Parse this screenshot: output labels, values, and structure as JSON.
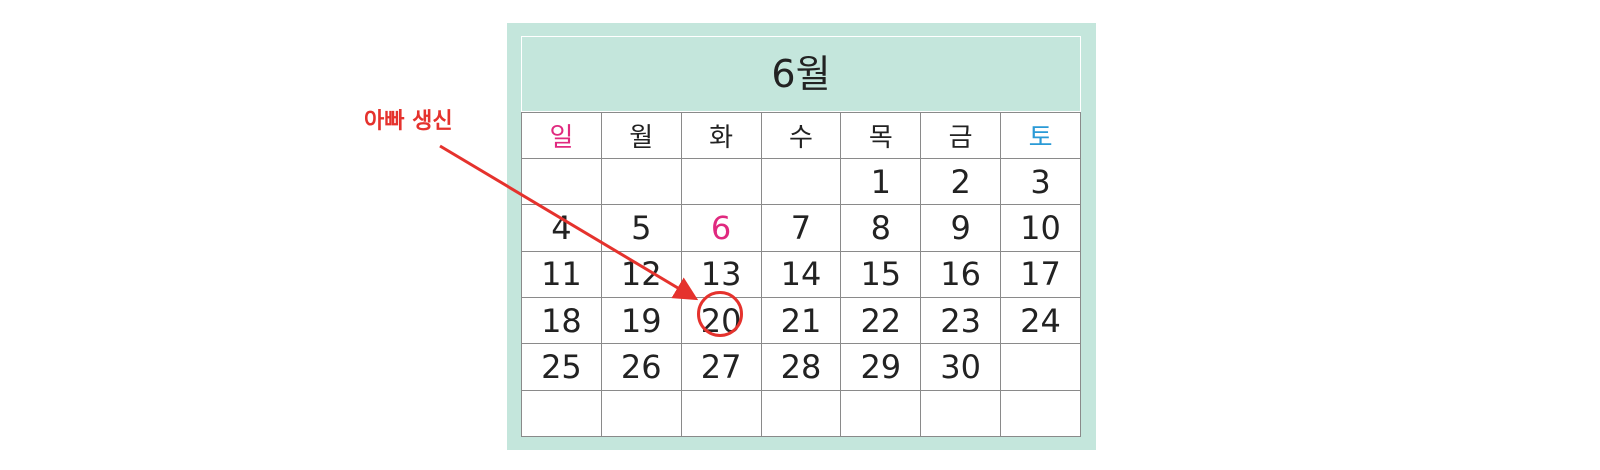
{
  "calendar": {
    "month_title": "6월",
    "weekdays": [
      "일",
      "월",
      "화",
      "수",
      "목",
      "금",
      "토"
    ],
    "weeks": [
      [
        "",
        "",
        "",
        "",
        "1",
        "2",
        "3"
      ],
      [
        "4",
        "5",
        "6",
        "7",
        "8",
        "9",
        "10"
      ],
      [
        "11",
        "12",
        "13",
        "14",
        "15",
        "16",
        "17"
      ],
      [
        "18",
        "19",
        "20",
        "21",
        "22",
        "23",
        "24"
      ],
      [
        "25",
        "26",
        "27",
        "28",
        "29",
        "30",
        ""
      ],
      [
        "",
        "",
        "",
        "",
        "",
        "",
        ""
      ]
    ],
    "holiday_date": "6",
    "highlighted_date": "20"
  },
  "annotation": {
    "text": "아빠 생신"
  },
  "colors": {
    "sunday": "#e0297f",
    "saturday": "#2a9ad6",
    "frame": "#c4e6dc",
    "annotation": "#e5322d"
  }
}
